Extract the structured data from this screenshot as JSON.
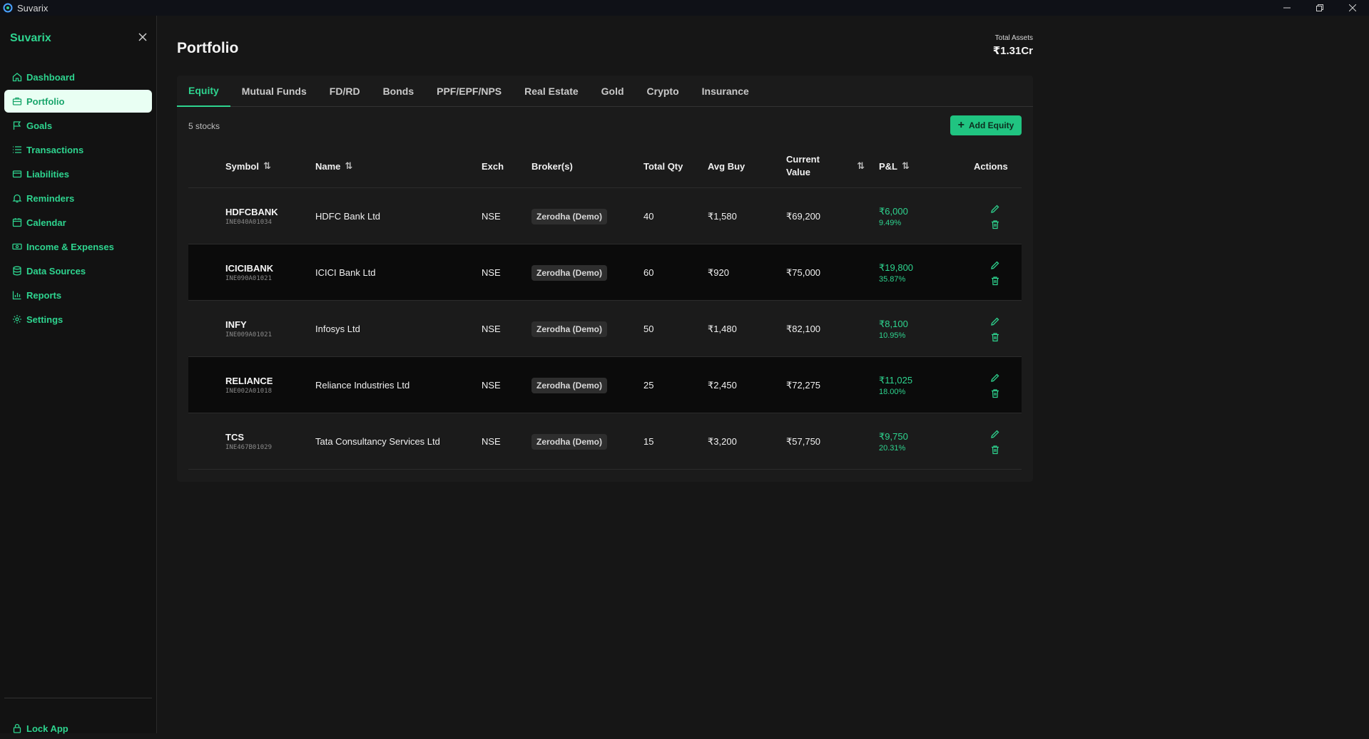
{
  "window": {
    "title": "Suvarix"
  },
  "sidebar": {
    "brand": "Suvarix",
    "items": [
      {
        "label": "Dashboard",
        "icon": "home-icon"
      },
      {
        "label": "Portfolio",
        "icon": "briefcase-icon",
        "active": true
      },
      {
        "label": "Goals",
        "icon": "flag-icon"
      },
      {
        "label": "Transactions",
        "icon": "list-icon"
      },
      {
        "label": "Liabilities",
        "icon": "wallet-icon"
      },
      {
        "label": "Reminders",
        "icon": "bell-icon"
      },
      {
        "label": "Calendar",
        "icon": "calendar-icon"
      },
      {
        "label": "Income & Expenses",
        "icon": "money-icon"
      },
      {
        "label": "Data Sources",
        "icon": "database-icon"
      },
      {
        "label": "Reports",
        "icon": "bar-chart-icon"
      },
      {
        "label": "Settings",
        "icon": "gear-icon"
      }
    ],
    "lock_label": "Lock App"
  },
  "header": {
    "title": "Portfolio",
    "total_assets_label": "Total Assets",
    "total_assets_value": "₹1.31Cr"
  },
  "tabs": [
    "Equity",
    "Mutual Funds",
    "FD/RD",
    "Bonds",
    "PPF/EPF/NPS",
    "Real Estate",
    "Gold",
    "Crypto",
    "Insurance"
  ],
  "active_tab": "Equity",
  "toolbar": {
    "count_label": "5 stocks",
    "add_label": "Add Equity"
  },
  "table": {
    "headers": {
      "symbol": "Symbol",
      "name": "Name",
      "exch": "Exch",
      "brokers": "Broker(s)",
      "qty": "Total Qty",
      "avg": "Avg Buy",
      "current_1": "Current",
      "current_2": "Value",
      "pnl": "P&L",
      "actions": "Actions"
    },
    "rows": [
      {
        "symbol": "HDFCBANK",
        "isin": "INE040A01034",
        "name": "HDFC Bank Ltd",
        "exch": "NSE",
        "broker": "Zerodha (Demo)",
        "qty": "40",
        "avg": "₹1,580",
        "current": "₹69,200",
        "pnl": "₹6,000",
        "pnl_pct": "9.49%"
      },
      {
        "symbol": "ICICIBANK",
        "isin": "INE090A01021",
        "name": "ICICI Bank Ltd",
        "exch": "NSE",
        "broker": "Zerodha (Demo)",
        "qty": "60",
        "avg": "₹920",
        "current": "₹75,000",
        "pnl": "₹19,800",
        "pnl_pct": "35.87%"
      },
      {
        "symbol": "INFY",
        "isin": "INE009A01021",
        "name": "Infosys Ltd",
        "exch": "NSE",
        "broker": "Zerodha (Demo)",
        "qty": "50",
        "avg": "₹1,480",
        "current": "₹82,100",
        "pnl": "₹8,100",
        "pnl_pct": "10.95%"
      },
      {
        "symbol": "RELIANCE",
        "isin": "INE002A01018",
        "name": "Reliance Industries Ltd",
        "exch": "NSE",
        "broker": "Zerodha (Demo)",
        "qty": "25",
        "avg": "₹2,450",
        "current": "₹72,275",
        "pnl": "₹11,025",
        "pnl_pct": "18.00%"
      },
      {
        "symbol": "TCS",
        "isin": "INE467B01029",
        "name": "Tata Consultancy Services Ltd",
        "exch": "NSE",
        "broker": "Zerodha (Demo)",
        "qty": "15",
        "avg": "₹3,200",
        "current": "₹57,750",
        "pnl": "₹9,750",
        "pnl_pct": "20.31%"
      }
    ]
  },
  "colors": {
    "accent": "#2ed48f",
    "background": "#161616",
    "panel": "#1b1b1b",
    "active_nav_bg": "#e9fff3"
  }
}
